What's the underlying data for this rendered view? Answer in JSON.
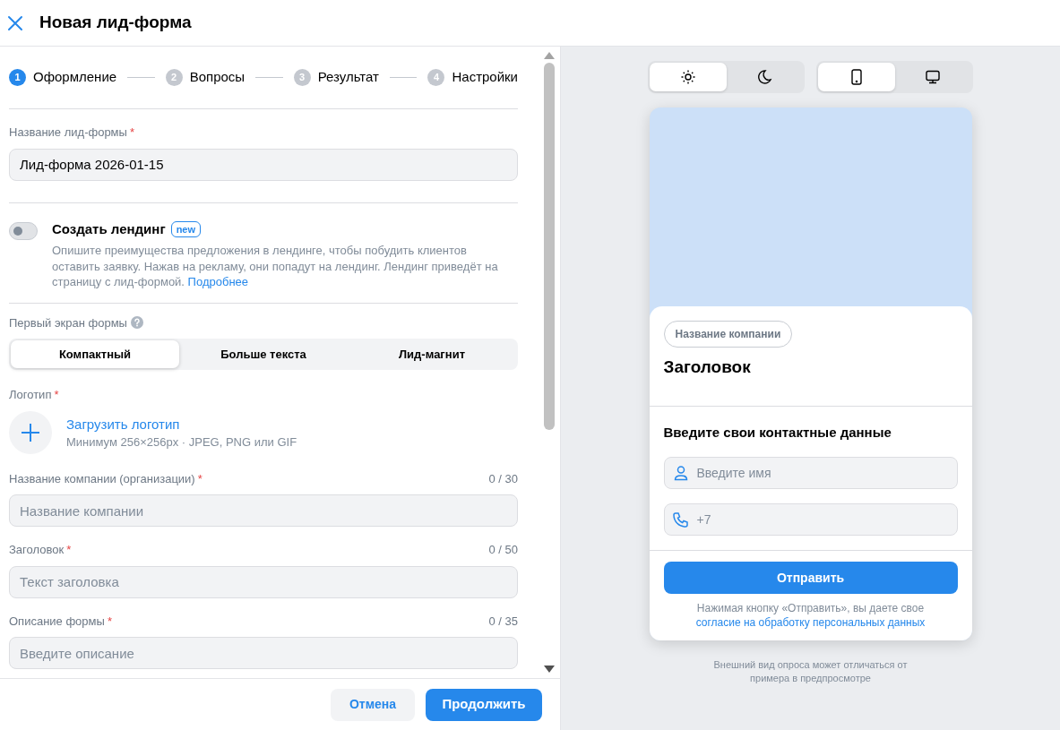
{
  "header": {
    "title": "Новая лид-форма"
  },
  "steps": [
    {
      "number": "1",
      "label": "Оформление",
      "selected": true
    },
    {
      "number": "2",
      "label": "Вопросы",
      "selected": false
    },
    {
      "number": "3",
      "label": "Результат",
      "selected": false
    },
    {
      "number": "4",
      "label": "Настройки",
      "selected": false
    }
  ],
  "lead_form_name": {
    "label": "Название лид-формы",
    "required_mark": "*",
    "value": "Лид-форма 2026-01-15"
  },
  "landing": {
    "on": false,
    "title": "Создать лендинг",
    "badge": "new",
    "description": "Опишите преимущества предложения в лендинге, чтобы побудить клиентов оставить заявку. Нажав на рекламу, они попадут на лендинг. Лендинг приведёт на страницу с лид-формой.",
    "link": "Подробнее"
  },
  "first_screen": {
    "label": "Первый экран формы",
    "options": [
      {
        "label": "Компактный",
        "selected": true
      },
      {
        "label": "Больше текста",
        "selected": false
      },
      {
        "label": "Лид-магнит",
        "selected": false
      }
    ]
  },
  "logo": {
    "label": "Логотип",
    "required_mark": "*",
    "upload_link": "Загрузить логотип",
    "hint": "Минимум 256×256px · JPEG, PNG или GIF"
  },
  "fields": [
    {
      "label": "Название компании (организации)",
      "required_mark": "*",
      "counter": "0 / 30",
      "placeholder": "Название компании"
    },
    {
      "label": "Заголовок",
      "required_mark": "*",
      "counter": "0 / 50",
      "placeholder": "Текст заголовка"
    },
    {
      "label": "Описание формы",
      "required_mark": "*",
      "counter": "0 / 35",
      "placeholder": "Введите описание"
    }
  ],
  "footer": {
    "cancel": "Отмена",
    "continue": "Продолжить"
  },
  "preview": {
    "theme_toggle": [
      {
        "kind": "light",
        "selected": true
      },
      {
        "kind": "dark",
        "selected": false
      }
    ],
    "device_toggle": [
      {
        "kind": "phone",
        "selected": true
      },
      {
        "kind": "desktop",
        "selected": false
      }
    ],
    "company_chip": "Название компании",
    "heading": "Заголовок",
    "contact_title": "Введите свои контактные данные",
    "inputs": [
      {
        "kind": "name",
        "placeholder": "Введите имя"
      },
      {
        "kind": "phone",
        "placeholder": "+7"
      }
    ],
    "submit": "Отправить",
    "consent_text": "Нажимая кнопку «Отправить», вы даете свое",
    "consent_link": "согласие на обработку персональных данных",
    "note": "Внешний вид опроса может отличаться от примера в предпросмотре"
  }
}
